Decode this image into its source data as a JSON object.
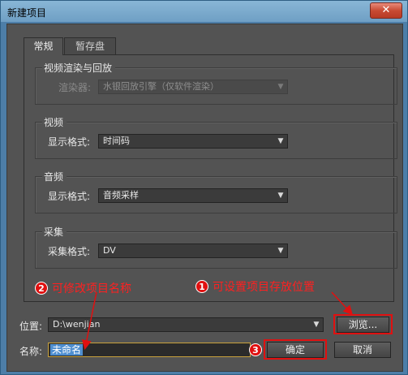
{
  "window": {
    "title": "新建项目",
    "close_label": "✕"
  },
  "tabs": [
    {
      "label": "常规",
      "active": true
    },
    {
      "label": "暂存盘",
      "active": false
    }
  ],
  "groups": {
    "video_render": {
      "legend": "视频渲染与回放",
      "label": "渲染器:",
      "value": "水银回放引擎（仅软件渲染）"
    },
    "video": {
      "legend": "视频",
      "label": "显示格式:",
      "value": "时间码"
    },
    "audio": {
      "legend": "音频",
      "label": "显示格式:",
      "value": "音频采样"
    },
    "capture": {
      "legend": "采集",
      "label": "采集格式:",
      "value": "DV"
    }
  },
  "location": {
    "label": "位置:",
    "value": "D:\\wenjian",
    "browse_label": "浏览..."
  },
  "name": {
    "label": "名称:",
    "value": "未命名"
  },
  "buttons": {
    "ok": "确定",
    "cancel": "取消"
  },
  "annotations": [
    {
      "number": "1",
      "text": "可设置项目存放位置"
    },
    {
      "number": "2",
      "text": "可修改项目名称"
    },
    {
      "number": "3",
      "text": ""
    }
  ],
  "colors": {
    "annotation_red": "#e01010",
    "panel_bg": "#535353",
    "title_blue": "#6f9fc4"
  }
}
